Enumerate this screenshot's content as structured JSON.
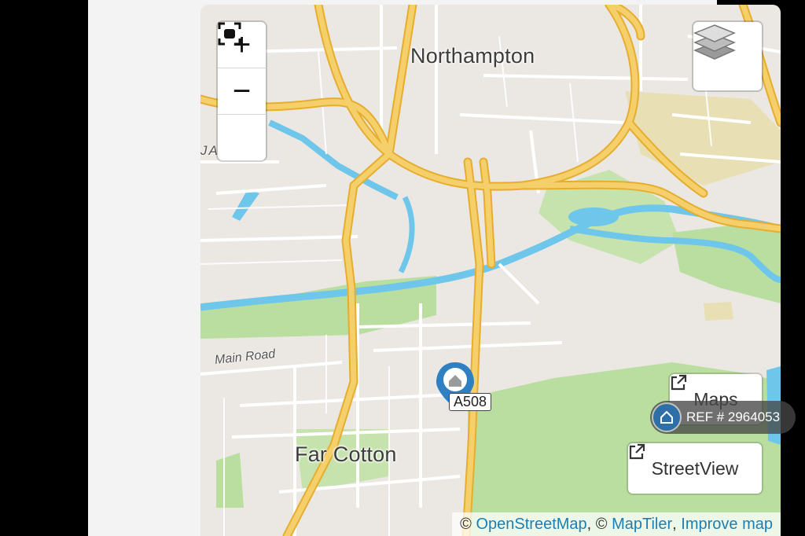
{
  "map": {
    "places": [
      "Northampton",
      "Far Cotton"
    ],
    "streets": [
      "Main Road"
    ],
    "area_label": "JA END",
    "road_shield": "A508",
    "marker_icon": "home-pin-icon",
    "colors": {
      "land": "#ebe8e3",
      "major_road": "#f2c24f",
      "minor_road": "#ffffff",
      "water": "#6ec6ea",
      "park": "#b9dea0",
      "marker": "#2f80c3"
    }
  },
  "controls": {
    "zoom_in": "+",
    "zoom_out": "−",
    "fullscreen_icon": "fullscreen-icon",
    "layers_icon": "layers-icon",
    "maps_label": "Maps",
    "streetview_label": "StreetView",
    "external_link_icon": "external-link-icon"
  },
  "attribution": {
    "prefix": "©",
    "osm": "OpenStreetMap",
    "sep1": ", ©",
    "maptiler": "MapTiler",
    "sep2": ",",
    "improve": "Improve map"
  },
  "ref_badge": {
    "text": "REF # 2964053",
    "icon": "home-icon"
  }
}
